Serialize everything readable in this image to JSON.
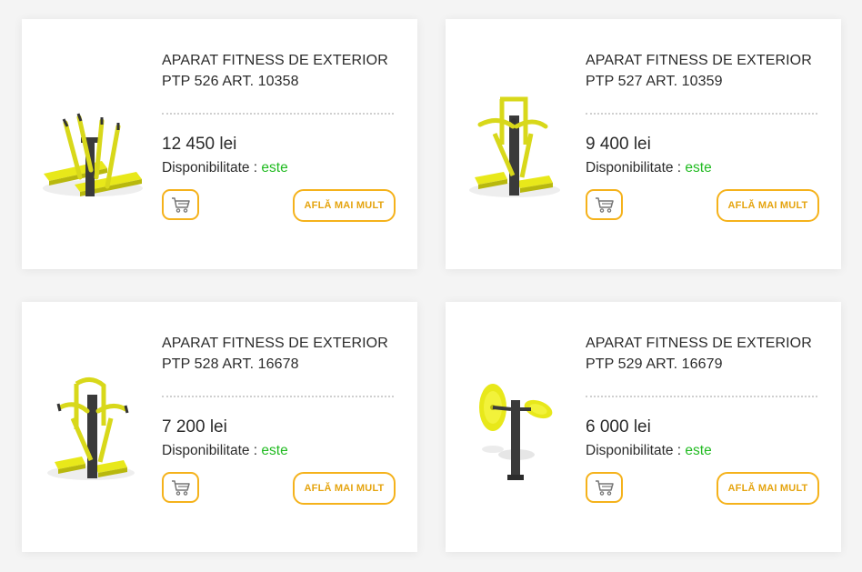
{
  "products": [
    {
      "title_line1": "APARAT FITNESS DE EXTERIOR",
      "title_line2": "PTP 526 ART. 10358",
      "price": "12 450 lei",
      "availability_label": "Disponibilitate :",
      "availability_value": "este",
      "more_label": "AFLĂ MAI MULT",
      "image_icon": "outdoor-ski-walker-double"
    },
    {
      "title_line1": "APARAT FITNESS DE EXTERIOR",
      "title_line2": "PTP 527 ART. 10359",
      "price": "9 400 lei",
      "availability_label": "Disponibilitate :",
      "availability_value": "este",
      "more_label": "AFLĂ MAI MULT",
      "image_icon": "outdoor-lat-pull-machine"
    },
    {
      "title_line1": "APARAT FITNESS DE EXTERIOR",
      "title_line2": "PTP 528 ART. 16678",
      "price": "7 200 lei",
      "availability_label": "Disponibilitate :",
      "availability_value": "este",
      "more_label": "AFLĂ MAI MULT",
      "image_icon": "outdoor-chest-press-machine"
    },
    {
      "title_line1": "APARAT FITNESS DE EXTERIOR",
      "title_line2": "PTP 529 ART. 16679",
      "price": "6 000 lei",
      "availability_label": "Disponibilitate :",
      "availability_value": "este",
      "more_label": "AFLĂ MAI MULT",
      "image_icon": "outdoor-tai-chi-wheel"
    }
  ],
  "colors": {
    "accent": "#f5b21b",
    "accent_text": "#e5a40f",
    "available": "#22bb22",
    "equipment_yellow": "#e8e81a",
    "equipment_dark": "#3a3a3a"
  },
  "icons": {
    "cart": "shopping-cart-icon"
  }
}
